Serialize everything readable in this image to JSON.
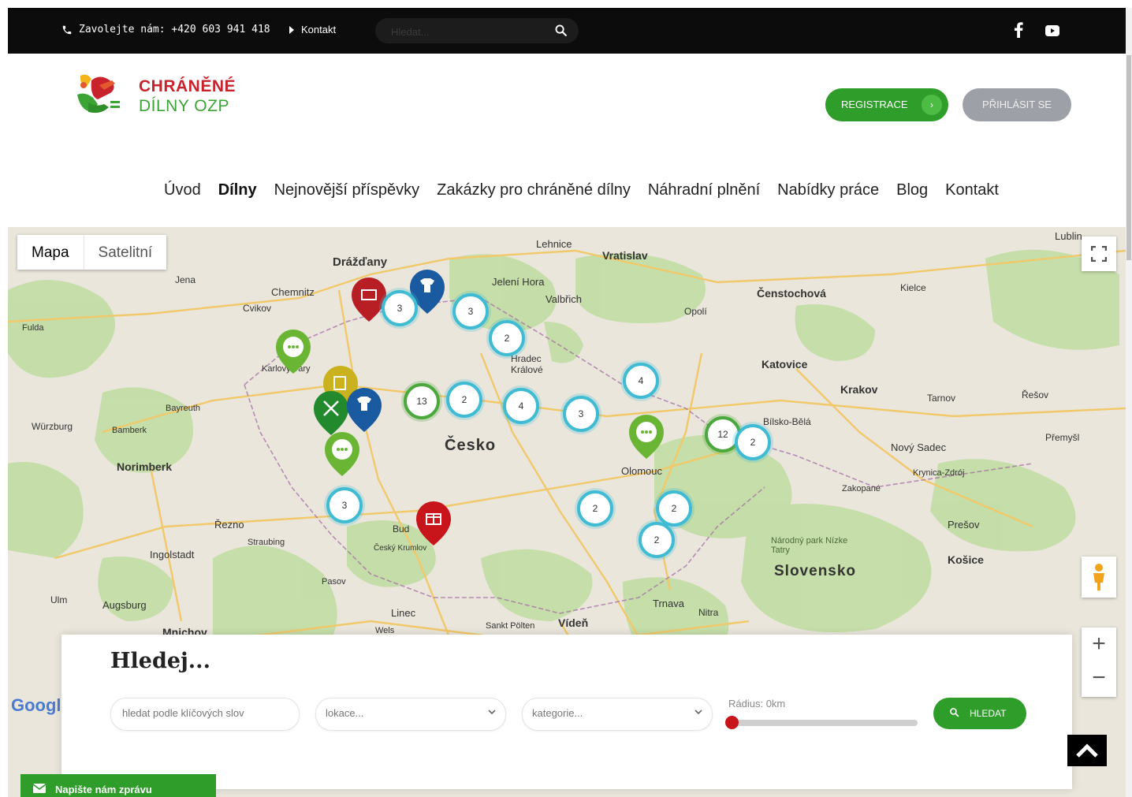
{
  "topbar": {
    "phone_text": "Zavolejte nám: +420 603 941 418",
    "kontakt_label": "Kontakt",
    "search_placeholder": "Hledat..."
  },
  "logo": {
    "line1": "CHRÁNĚNÉ",
    "line2": "DÍLNY OZP"
  },
  "header": {
    "register_label": "REGISTRACE",
    "login_label": "PŘIHLÁSIT SE"
  },
  "nav": {
    "items": [
      "Úvod",
      "Dílny",
      "Nejnovější příspěvky",
      "Zakázky pro chráněné dílny",
      "Náhradní plnění",
      "Nabídky práce",
      "Blog",
      "Kontakt"
    ],
    "active": "Dílny"
  },
  "map": {
    "type_map": "Mapa",
    "type_satellite": "Satelitní",
    "places": [
      {
        "name": "Drážďany"
      },
      {
        "name": "Chemnitz"
      },
      {
        "name": "Cvikov"
      },
      {
        "name": "Jena"
      },
      {
        "name": "Fulda"
      },
      {
        "name": "Lehnice"
      },
      {
        "name": "Vratislav"
      },
      {
        "name": "Jelení Hora"
      },
      {
        "name": "Valbřich"
      },
      {
        "name": "Opolí"
      },
      {
        "name": "Čenstochová"
      },
      {
        "name": "Kielce"
      },
      {
        "name": "Lublin"
      },
      {
        "name": "Katovice"
      },
      {
        "name": "Krakov"
      },
      {
        "name": "Tarnov"
      },
      {
        "name": "Řešov"
      },
      {
        "name": "Hradec Králové"
      },
      {
        "name": "Česko"
      },
      {
        "name": "Olomouc"
      },
      {
        "name": "Bílsko-Bělá"
      },
      {
        "name": "Nový Sadec"
      },
      {
        "name": "Přemyšl"
      },
      {
        "name": "Würzburg"
      },
      {
        "name": "Bamberk"
      },
      {
        "name": "Bayreuth"
      },
      {
        "name": "Norimberk"
      },
      {
        "name": "Řezno"
      },
      {
        "name": "Straubing"
      },
      {
        "name": "Ingolstadt"
      },
      {
        "name": "Pasov"
      },
      {
        "name": "Augsburg"
      },
      {
        "name": "Ulm"
      },
      {
        "name": "Mnichov"
      },
      {
        "name": "Linec"
      },
      {
        "name": "Wels"
      },
      {
        "name": "Sankt Pölten"
      },
      {
        "name": "Vídeň"
      },
      {
        "name": "Trnava"
      },
      {
        "name": "Nitra"
      },
      {
        "name": "Český Krumlov"
      },
      {
        "name": "Budějovice"
      },
      {
        "name": "Slovensko"
      },
      {
        "name": "Národný park Nízke Tatry"
      },
      {
        "name": "Zakopané"
      },
      {
        "name": "Prešov"
      },
      {
        "name": "Košice"
      },
      {
        "name": "Krynica-Zdrój"
      },
      {
        "name": "Karlovy Vary"
      }
    ],
    "clusters": [
      "3",
      "3",
      "2",
      "13",
      "2",
      "4",
      "3",
      "4",
      "12",
      "2",
      "3",
      "2",
      "2",
      "2"
    ],
    "google_label": "Google",
    "zoom_in": "+",
    "zoom_out": "−"
  },
  "search_panel": {
    "title": "Hledej...",
    "keyword_placeholder": "hledat podle klíčových slov",
    "location_value": "lokace...",
    "category_value": "kategorie...",
    "radius_label": "Rádius: 0km",
    "radius_km": 0,
    "search_label": "HLEDAT"
  },
  "chat": {
    "label": "Napište nám zprávu"
  },
  "colors": {
    "brand_green": "#2e9d2a",
    "brand_red": "#c8232c",
    "cluster_ring": "#3fbcd4",
    "topbar": "#0c0c0c"
  }
}
